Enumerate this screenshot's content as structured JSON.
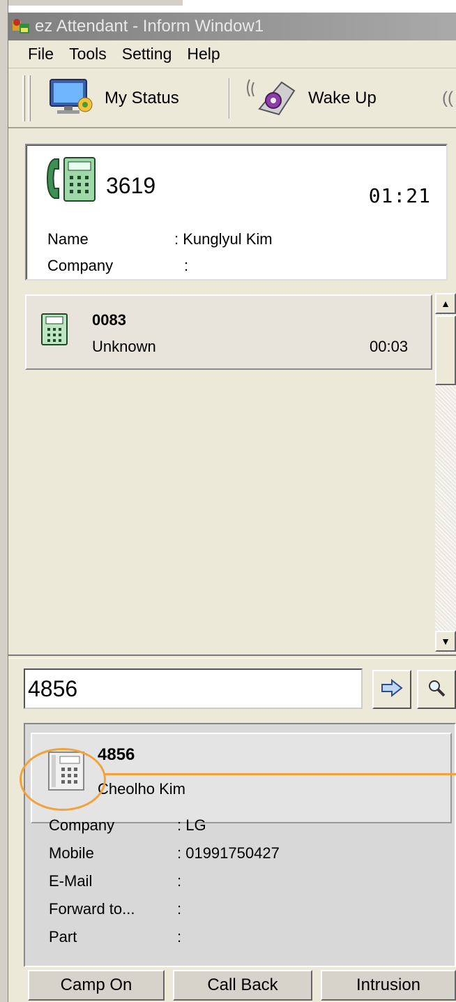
{
  "window": {
    "title": "ez Attendant - Inform Window1"
  },
  "menu": [
    "File",
    "Tools",
    "Setting",
    "Help"
  ],
  "toolbar": {
    "my_status": "My Status",
    "wake_up": "Wake Up",
    "more": "(("
  },
  "active_call": {
    "extension": "3619",
    "duration": "01:21",
    "name_label": "Name",
    "name_value": ": Kunglyul Kim",
    "company_label": "Company",
    "company_value": ":"
  },
  "queue": [
    {
      "extension": "0083",
      "name": "Unknown",
      "duration": "00:03"
    }
  ],
  "search": {
    "value": "4856"
  },
  "detail": {
    "extension": "4856",
    "name": "Cheolho Kim",
    "fields": [
      {
        "label": "Company",
        "value": ":  LG"
      },
      {
        "label": "Mobile",
        "value": ":  01991750427"
      },
      {
        "label": "E-Mail",
        "value": ":"
      },
      {
        "label": "Forward to...",
        "value": ":"
      },
      {
        "label": "Part",
        "value": ":"
      }
    ]
  },
  "buttons": {
    "camp_on": "Camp On",
    "call_back": "Call Back",
    "intrusion": "Intrusion"
  },
  "colors": {
    "highlight": "#f2a23a",
    "phone_green": "#3f8f55",
    "titlebar": "#8c8c8c"
  }
}
